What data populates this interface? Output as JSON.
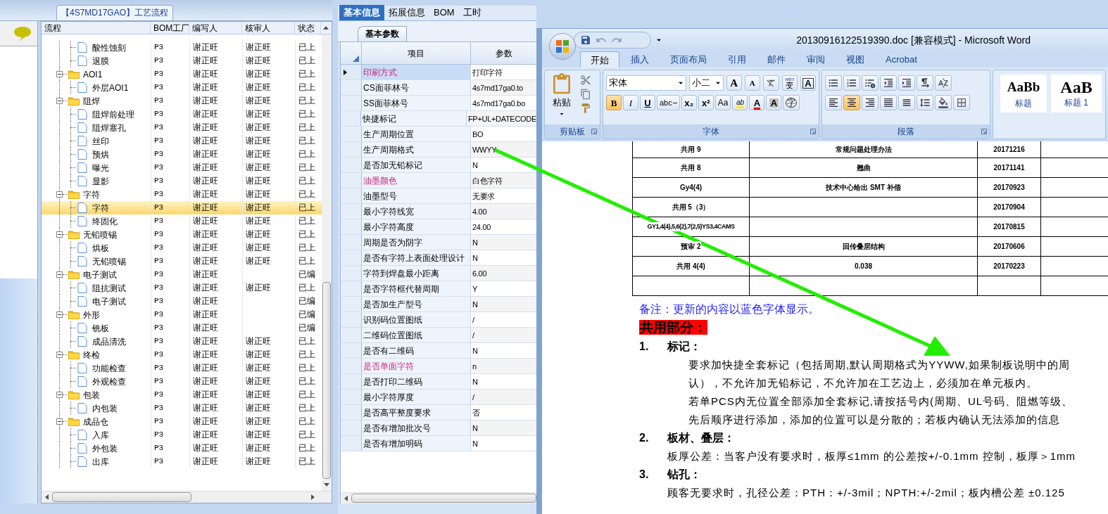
{
  "process_panel": {
    "title": "【4S7MD17GAO】工艺流程",
    "columns": [
      "流程",
      "BOM工厂",
      "编写人",
      "核审人",
      "状态"
    ],
    "rows": [
      {
        "kind": "step",
        "label": "酸性蚀刻",
        "factory": "P3",
        "author": "谢正旺",
        "reviewer": "谢正旺",
        "status": "已上",
        "selected": false
      },
      {
        "kind": "step",
        "label": "退膜",
        "factory": "P3",
        "author": "谢正旺",
        "reviewer": "谢正旺",
        "status": "已上",
        "selected": false
      },
      {
        "kind": "folder",
        "label": "AOI1",
        "factory": "P3",
        "author": "谢正旺",
        "reviewer": "谢正旺",
        "status": "已上",
        "selected": false,
        "expanded": true,
        "children": [
          {
            "kind": "step",
            "label": "外层AOI1",
            "factory": "P3",
            "author": "谢正旺",
            "reviewer": "谢正旺",
            "status": "已上",
            "selected": false
          }
        ]
      },
      {
        "kind": "folder",
        "label": "阻焊",
        "factory": "P3",
        "author": "谢正旺",
        "reviewer": "谢正旺",
        "status": "已上",
        "selected": false,
        "expanded": true,
        "children": [
          {
            "kind": "step",
            "label": "阻焊前处理",
            "factory": "P3",
            "author": "谢正旺",
            "reviewer": "谢正旺",
            "status": "已上",
            "selected": false
          },
          {
            "kind": "step",
            "label": "阻焊塞孔",
            "factory": "P3",
            "author": "谢正旺",
            "reviewer": "谢正旺",
            "status": "已上",
            "selected": false
          },
          {
            "kind": "step",
            "label": "丝印",
            "factory": "P3",
            "author": "谢正旺",
            "reviewer": "谢正旺",
            "status": "已上",
            "selected": false
          },
          {
            "kind": "step",
            "label": "预烘",
            "factory": "P3",
            "author": "谢正旺",
            "reviewer": "谢正旺",
            "status": "已上",
            "selected": false
          },
          {
            "kind": "step",
            "label": "曝光",
            "factory": "P3",
            "author": "谢正旺",
            "reviewer": "谢正旺",
            "status": "已上",
            "selected": false
          },
          {
            "kind": "step",
            "label": "显影",
            "factory": "P3",
            "author": "谢正旺",
            "reviewer": "谢正旺",
            "status": "已上",
            "selected": false
          }
        ]
      },
      {
        "kind": "folder",
        "label": "字符",
        "factory": "P3",
        "author": "谢正旺",
        "reviewer": "谢正旺",
        "status": "已上",
        "selected": false,
        "expanded": true,
        "children": [
          {
            "kind": "step",
            "label": "字符",
            "factory": "P3",
            "author": "谢正旺",
            "reviewer": "谢正旺",
            "status": "已上",
            "selected": true
          },
          {
            "kind": "step",
            "label": "终固化",
            "factory": "P3",
            "author": "谢正旺",
            "reviewer": "谢正旺",
            "status": "已上",
            "selected": false
          }
        ]
      },
      {
        "kind": "folder",
        "label": "无铅喷锡",
        "factory": "P3",
        "author": "谢正旺",
        "reviewer": "谢正旺",
        "status": "已上",
        "selected": false,
        "expanded": true,
        "children": [
          {
            "kind": "step",
            "label": "烘板",
            "factory": "P3",
            "author": "谢正旺",
            "reviewer": "谢正旺",
            "status": "已上",
            "selected": false
          },
          {
            "kind": "step",
            "label": "无铅喷锡",
            "factory": "P3",
            "author": "谢正旺",
            "reviewer": "谢正旺",
            "status": "已上",
            "selected": false
          }
        ]
      },
      {
        "kind": "folder",
        "label": "电子测试",
        "factory": "P3",
        "author": "谢正旺",
        "status": "已编",
        "selected": false,
        "expanded": true,
        "children": [
          {
            "kind": "step",
            "label": "阻抗测试",
            "factory": "P3",
            "author": "谢正旺",
            "reviewer": "谢正旺",
            "status": "已上",
            "selected": false
          },
          {
            "kind": "step",
            "label": "电子测试",
            "factory": "P3",
            "author": "谢正旺",
            "status": "已编",
            "selected": false
          }
        ]
      },
      {
        "kind": "folder",
        "label": "外形",
        "factory": "P3",
        "author": "谢正旺",
        "status": "已编",
        "selected": false,
        "expanded": true,
        "children": [
          {
            "kind": "step",
            "label": "铣板",
            "factory": "P3",
            "author": "谢正旺",
            "status": "已编",
            "selected": false
          },
          {
            "kind": "step",
            "label": "成品清洗",
            "factory": "P3",
            "author": "谢正旺",
            "reviewer": "谢正旺",
            "status": "已上",
            "selected": false
          }
        ]
      },
      {
        "kind": "folder",
        "label": "终检",
        "factory": "P3",
        "author": "谢正旺",
        "reviewer": "谢正旺",
        "status": "已上",
        "selected": false,
        "expanded": true,
        "children": [
          {
            "kind": "step",
            "label": "功能检查",
            "factory": "P3",
            "author": "谢正旺",
            "reviewer": "谢正旺",
            "status": "已上",
            "selected": false
          },
          {
            "kind": "step",
            "label": "外观检查",
            "factory": "P3",
            "author": "谢正旺",
            "reviewer": "谢正旺",
            "status": "已上",
            "selected": false
          }
        ]
      },
      {
        "kind": "folder",
        "label": "包装",
        "factory": "P3",
        "author": "谢正旺",
        "reviewer": "谢正旺",
        "status": "已上",
        "selected": false,
        "expanded": true,
        "children": [
          {
            "kind": "step",
            "label": "内包装",
            "factory": "P3",
            "author": "谢正旺",
            "reviewer": "谢正旺",
            "status": "已上",
            "selected": false
          }
        ]
      },
      {
        "kind": "folder",
        "label": "成品仓",
        "factory": "P3",
        "author": "谢正旺",
        "reviewer": "谢正旺",
        "status": "已上",
        "selected": false,
        "expanded": true,
        "children": [
          {
            "kind": "step",
            "label": "入库",
            "factory": "P3",
            "author": "谢正旺",
            "reviewer": "谢正旺",
            "status": "已上",
            "selected": false
          },
          {
            "kind": "step",
            "label": "外包装",
            "factory": "P3",
            "author": "谢正旺",
            "reviewer": "谢正旺",
            "status": "已上",
            "selected": false
          },
          {
            "kind": "step",
            "label": "出库",
            "factory": "P3",
            "author": "谢正旺",
            "reviewer": "谢正旺",
            "status": "已上",
            "selected": false
          }
        ]
      }
    ]
  },
  "info_panel": {
    "tabs": [
      {
        "label": "基本信息",
        "selected": true
      },
      {
        "label": "拓展信息",
        "selected": false
      },
      {
        "label": "BOM",
        "selected": false
      },
      {
        "label": "工时",
        "selected": false
      }
    ],
    "subtab": "基本参数",
    "columns": [
      "项目",
      "参数"
    ],
    "rows": [
      {
        "item": "印刷方式",
        "value": "打印字符",
        "highlight": true,
        "selected": true
      },
      {
        "item": "CS面菲林号",
        "value": "4s7md17ga0.to",
        "highlight": false,
        "selected": false
      },
      {
        "item": "SS面菲林号",
        "value": "4s7md17ga0.bo",
        "highlight": false,
        "selected": false
      },
      {
        "item": "快捷标记",
        "value": "FP+UL+DATECODE",
        "highlight": false,
        "selected": false
      },
      {
        "item": "生产周期位置",
        "value": "BO",
        "highlight": false,
        "selected": false
      },
      {
        "item": "生产周期格式",
        "value": "WWYY",
        "highlight": false,
        "selected": false
      },
      {
        "item": "是否加无铅标记",
        "value": "N",
        "highlight": false,
        "selected": false
      },
      {
        "item": "油墨颜色",
        "value": "白色字符",
        "highlight": true,
        "selected": false
      },
      {
        "item": "油墨型号",
        "value": "无要求",
        "highlight": false,
        "selected": false
      },
      {
        "item": "最小字符线宽",
        "value": "4.00",
        "highlight": false,
        "selected": false
      },
      {
        "item": "最小字符高度",
        "value": "24.00",
        "highlight": false,
        "selected": false
      },
      {
        "item": "周期是否为阴字",
        "value": "N",
        "highlight": false,
        "selected": false
      },
      {
        "item": "是否有字符上表面处理设计",
        "value": "N",
        "highlight": false,
        "selected": false
      },
      {
        "item": "字符到焊盘最小距离",
        "value": "6.00",
        "highlight": false,
        "selected": false
      },
      {
        "item": "是否字符框代替周期",
        "value": "Y",
        "highlight": false,
        "selected": false
      },
      {
        "item": "是否加生产型号",
        "value": "N",
        "highlight": false,
        "selected": false
      },
      {
        "item": "识别码位置图纸",
        "value": "/",
        "highlight": false,
        "selected": false
      },
      {
        "item": "二维码位置图纸",
        "value": "/",
        "highlight": false,
        "selected": false
      },
      {
        "item": "是否有二维码",
        "value": "N",
        "highlight": false,
        "selected": false
      },
      {
        "item": "是否单面字符",
        "value": "n",
        "highlight": true,
        "selected": false
      },
      {
        "item": "是否打印二维码",
        "value": "N",
        "highlight": false,
        "selected": false
      },
      {
        "item": "最小字符厚度",
        "value": "/",
        "highlight": false,
        "selected": false
      },
      {
        "item": "是否高平整度要求",
        "value": "否",
        "highlight": false,
        "selected": false
      },
      {
        "item": "是否有增加批次号",
        "value": "N",
        "highlight": false,
        "selected": false
      },
      {
        "item": "是否有增加明码",
        "value": "N",
        "highlight": false,
        "selected": false
      }
    ]
  },
  "word": {
    "title": "20130916122519390.doc [兼容模式] - Microsoft Word",
    "tabs": [
      {
        "label": "开始",
        "selected": true
      },
      {
        "label": "插入",
        "selected": false
      },
      {
        "label": "页面布局",
        "selected": false
      },
      {
        "label": "引用",
        "selected": false
      },
      {
        "label": "邮件",
        "selected": false
      },
      {
        "label": "审阅",
        "selected": false
      },
      {
        "label": "视图",
        "selected": false
      },
      {
        "label": "Acrobat",
        "selected": false
      }
    ],
    "clipboard": {
      "paste": "粘贴",
      "label": "剪贴板"
    },
    "font": {
      "name": "宋体",
      "size": "小二",
      "label": "字体",
      "top_buttons": [
        {
          "kind": "grow",
          "label": "A"
        },
        {
          "kind": "shrink",
          "label": "A"
        },
        {
          "kind": "clear"
        },
        {
          "kind": "phonetic",
          "label": "变",
          "top": "wén"
        },
        {
          "kind": "border",
          "label": "A"
        }
      ],
      "buttons": [
        {
          "kind": "bold",
          "label": "B",
          "pressed": true
        },
        {
          "kind": "italic",
          "label": "I",
          "pressed": false
        },
        {
          "kind": "underline",
          "label": "U",
          "pressed": false
        },
        {
          "kind": "strike",
          "label": "abc",
          "pressed": false
        },
        {
          "kind": "sub",
          "label": "x₂",
          "pressed": false
        },
        {
          "kind": "sup",
          "label": "x²",
          "pressed": false
        },
        {
          "kind": "case",
          "label": "Aa",
          "pressed": false
        },
        {
          "kind": "highlight",
          "label": "ab",
          "pressed": false
        },
        {
          "kind": "color",
          "label": "A",
          "pressed": false
        },
        {
          "kind": "shade",
          "label": "A",
          "pressed": false
        },
        {
          "kind": "enclose",
          "label": "字",
          "pressed": false
        }
      ]
    },
    "paragraph": {
      "label": "段落",
      "alignments": [
        {
          "kind": "left",
          "selected": false
        },
        {
          "kind": "center",
          "selected": true
        },
        {
          "kind": "right",
          "selected": false
        },
        {
          "kind": "justify",
          "selected": false
        },
        {
          "kind": "distributed",
          "selected": false
        }
      ]
    },
    "styles": [
      {
        "sample": "AaBb",
        "name": "标题"
      },
      {
        "sample": "AaB",
        "name": "标题 1"
      }
    ]
  },
  "document": {
    "table": {
      "rows": [
        {
          "column_1": "共用 9",
          "column_2": "常规问题处理办法",
          "column_3": "20171216"
        },
        {
          "column_1": "共用 8",
          "column_2": "翘曲",
          "column_3": "20171141"
        },
        {
          "column_1": "Gy4(4)",
          "column_2": "技术中心给出 SMT 补偿",
          "column_3": "20170923"
        },
        {
          "column_1": "共用 5（3）",
          "column_3": "20170904"
        },
        {
          "column_1": "GY1,4(4),5,6(2),7(2,5)YS3,4CAMS",
          "column_3": "20170815"
        },
        {
          "column_1": "预审 2",
          "column_2": "回传叠层结构",
          "column_3": "20170606"
        },
        {
          "column_1": "共用 4(4)",
          "column_2": "0.038",
          "column_3": "20170223"
        },
        {}
      ]
    },
    "note": "备注：更新的内容以蓝色字体显示。",
    "heading": "共用部分：",
    "sections": [
      {
        "number": "1.",
        "title": "标记：",
        "kind": "indented",
        "lines": [
          "要求加快捷全套标记（包括周期,默认周期格式为YYWW,如果制板说明中的周",
          "认），不允许加无铅标记，不允许加在工艺边上，必须加在单元板内。",
          "若单PCS内无位置全部添加全套标记,请按括号内(周期、UL号码、阻燃等级、",
          "先后顺序进行添加，添加的位置可以是分散的；若板内确认无法添加的信息"
        ]
      },
      {
        "number": "2.",
        "title": "板材、叠层：",
        "kind": "plain",
        "lines": [
          "板厚公差：当客户没有要求时，板厚≤1mm 的公差按+/-0.1mm 控制，板厚＞1mm"
        ]
      },
      {
        "number": "3.",
        "title": "钻孔：",
        "kind": "plain",
        "lines": [
          "顾客无要求时，孔径公差：PTH：+/-3mil；NPTH:+/-2mil；板内槽公差  ±0.125"
        ]
      }
    ]
  }
}
